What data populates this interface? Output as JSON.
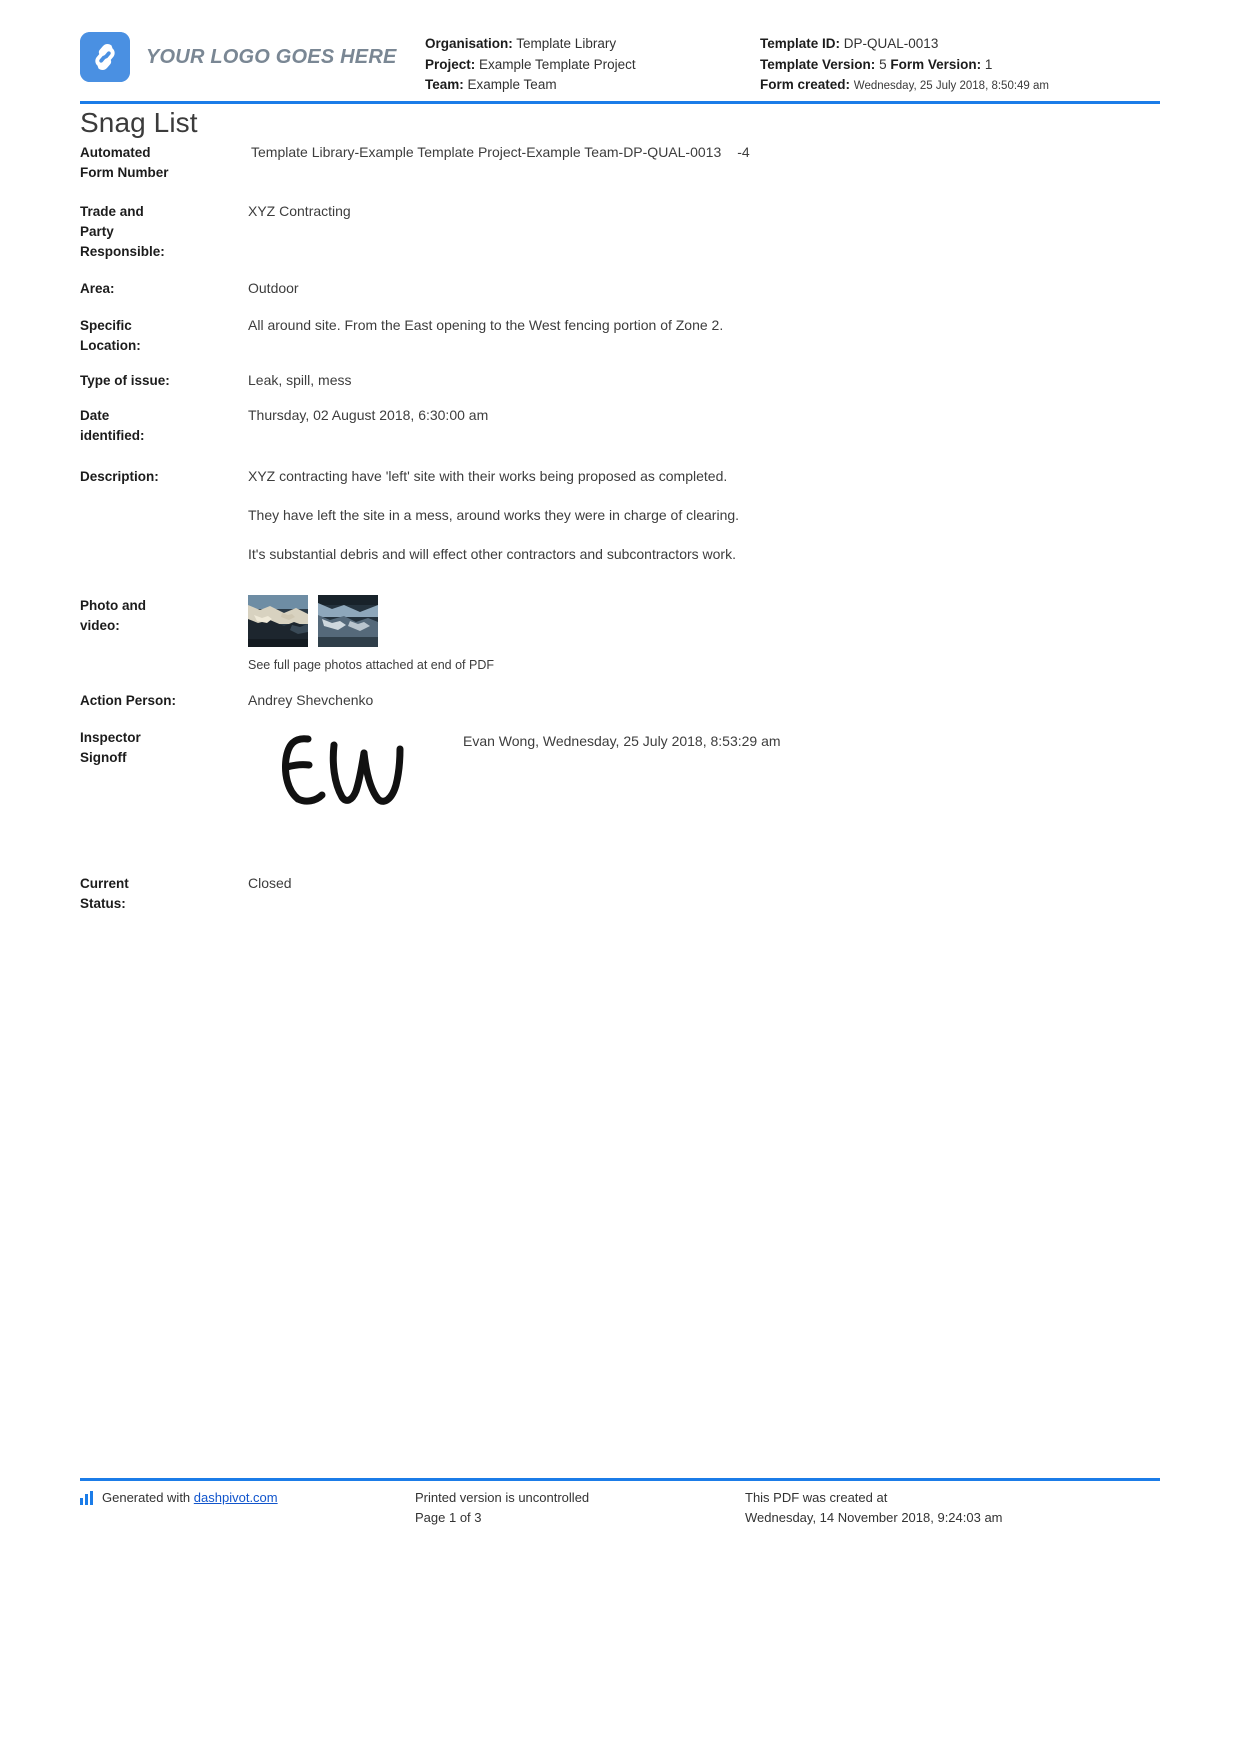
{
  "brand": {
    "logo_text": "YOUR LOGO GOES HERE",
    "accent_color": "#1b7ce8",
    "logo_bg_color": "#4a90e2",
    "logo_icon": "s-mark-icon"
  },
  "header": {
    "meta_left": [
      {
        "label": "Organisation:",
        "value": "Template Library"
      },
      {
        "label": "Project:",
        "value": "Example Template Project"
      },
      {
        "label": "Team:",
        "value": "Example Team"
      }
    ],
    "meta_right": {
      "template_id_label": "Template ID:",
      "template_id_value": "DP-QUAL-0013",
      "template_version_label": "Template Version:",
      "template_version_value": "5",
      "form_version_label": "Form Version:",
      "form_version_value": "1",
      "form_created_label": "Form created:",
      "form_created_value": "Wednesday, 25 July 2018, 8:50:49 am"
    }
  },
  "document": {
    "title": "Snag List"
  },
  "fields": {
    "automated_form_number": {
      "label_line1": "Automated",
      "label_line2": "Form Number",
      "value": "Template Library-Example Template Project-Example Team-DP-QUAL-0013",
      "value_suffix": "-4"
    },
    "trade_and_party": {
      "label_line1": "Trade and",
      "label_line2": "Party",
      "label_line3": "Responsible:",
      "value": "XYZ Contracting"
    },
    "area": {
      "label": "Area:",
      "value": "Outdoor"
    },
    "specific_location": {
      "label_line1": "Specific",
      "label_line2": "Location:",
      "value": "All around site. From the East opening to the West fencing portion of Zone 2."
    },
    "type_of_issue": {
      "label": "Type of issue:",
      "value": "Leak, spill, mess"
    },
    "date_identified": {
      "label_line1": "Date",
      "label_line2": "identified:",
      "value": "Thursday, 02 August 2018, 6:30:00 am"
    },
    "description": {
      "label": "Description:",
      "paragraph1": "XYZ contracting have 'left' site with their works being proposed as completed.",
      "paragraph2": "They have left the site in a mess, around works they were in charge of clearing.",
      "paragraph3": "It's substantial debris and will effect other contractors and subcontractors work."
    },
    "photo_and_video": {
      "label_line1": "Photo and",
      "label_line2": "video:",
      "note": "See full page photos attached at end of PDF",
      "thumbnails": [
        {
          "name": "site-debris-photo-1"
        },
        {
          "name": "site-debris-photo-2"
        }
      ]
    },
    "action_person": {
      "label": "Action Person:",
      "value": "Andrey Shevchenko"
    },
    "inspector_signoff": {
      "label_line1": "Inspector",
      "label_line2": "Signoff",
      "signature_initials": "EW",
      "value": "Evan Wong, Wednesday, 25 July 2018, 8:53:29 am"
    },
    "current_status": {
      "label_line1": "Current",
      "label_line2": "Status:",
      "value": "Closed"
    }
  },
  "footer": {
    "generated_prefix": "Generated with",
    "generated_link": "dashpivot.com",
    "uncontrolled_text": "Printed version is uncontrolled",
    "page_text": "Page 1 of 3",
    "created_at_label": "This PDF was created at",
    "created_at_value": "Wednesday, 14 November 2018, 9:24:03 am"
  }
}
